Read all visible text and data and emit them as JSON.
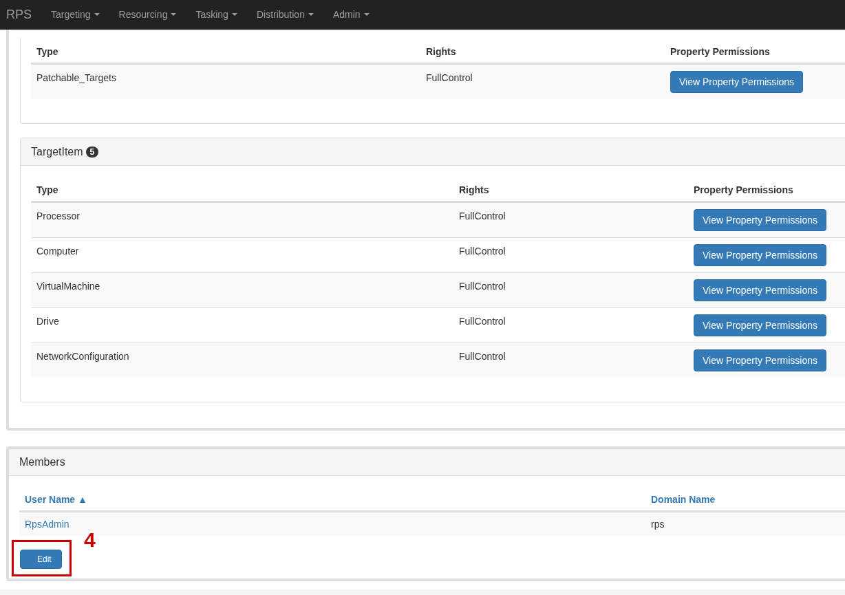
{
  "navbar": {
    "brand": "RPS",
    "menus": [
      {
        "label": "Targeting"
      },
      {
        "label": "Resourcing"
      },
      {
        "label": "Tasking"
      },
      {
        "label": "Distribution"
      },
      {
        "label": "Admin"
      }
    ]
  },
  "permission_panels": [
    {
      "columns": [
        "Type",
        "Rights",
        "Property Permissions"
      ],
      "rows": [
        {
          "type": "Patchable_Targets",
          "rights": "FullControl",
          "action": "View Property Permissions"
        }
      ]
    },
    {
      "title": "TargetItem",
      "count": "5",
      "columns": [
        "Type",
        "Rights",
        "Property Permissions"
      ],
      "rows": [
        {
          "type": "Processor",
          "rights": "FullControl",
          "action": "View Property Permissions"
        },
        {
          "type": "Computer",
          "rights": "FullControl",
          "action": "View Property Permissions"
        },
        {
          "type": "VirtualMachine",
          "rights": "FullControl",
          "action": "View Property Permissions"
        },
        {
          "type": "Drive",
          "rights": "FullControl",
          "action": "View Property Permissions"
        },
        {
          "type": "NetworkConfiguration",
          "rights": "FullControl",
          "action": "View Property Permissions"
        }
      ]
    }
  ],
  "members": {
    "title": "Members",
    "columns": [
      "User Name ▲",
      "Domain Name"
    ],
    "rows": [
      {
        "user_name": "RpsAdmin",
        "domain_name": "rps"
      }
    ],
    "edit_button": "Edit"
  },
  "annotation": {
    "label": "4"
  }
}
